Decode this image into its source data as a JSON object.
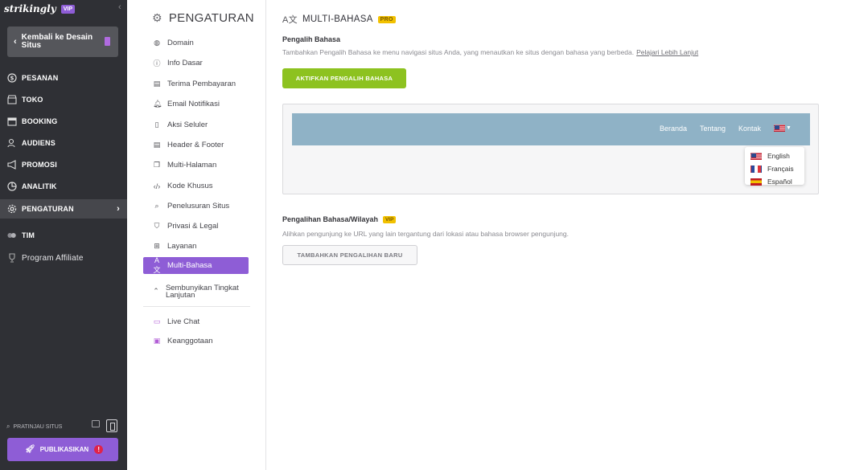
{
  "brand": {
    "logo": "strikingly",
    "vip": "VIP"
  },
  "back": {
    "label": "Kembali ke Desain Situs"
  },
  "nav": [
    {
      "label": "PESANAN",
      "icon": "dollar-icon"
    },
    {
      "label": "TOKO",
      "icon": "store-icon"
    },
    {
      "label": "BOOKING",
      "icon": "calendar-icon"
    },
    {
      "label": "AUDIENS",
      "icon": "people-icon"
    },
    {
      "label": "PROMOSI",
      "icon": "megaphone-icon"
    },
    {
      "label": "ANALITIK",
      "icon": "chart-icon"
    },
    {
      "label": "PENGATURAN",
      "icon": "gear-icon"
    },
    {
      "label": "TIM",
      "icon": "team-icon"
    },
    {
      "label": "Program Affiliate",
      "icon": "trophy-icon"
    }
  ],
  "preview": {
    "label": "PRATINJAU SITUS"
  },
  "publish": {
    "label": "PUBLIKASIKAN"
  },
  "settings": {
    "title": "PENGATURAN",
    "items": [
      {
        "label": "Domain",
        "icon": "globe-icon"
      },
      {
        "label": "Info Dasar",
        "icon": "info-icon"
      },
      {
        "label": "Terima Pembayaran",
        "icon": "payment-icon"
      },
      {
        "label": "Email Notifikasi",
        "icon": "bell-icon"
      },
      {
        "label": "Aksi Seluler",
        "icon": "mobile-icon"
      },
      {
        "label": "Header & Footer",
        "icon": "layout-icon"
      },
      {
        "label": "Multi-Halaman",
        "icon": "pages-icon"
      },
      {
        "label": "Kode Khusus",
        "icon": "code-icon"
      },
      {
        "label": "Penelusuran Situs",
        "icon": "search-icon"
      },
      {
        "label": "Privasi & Legal",
        "icon": "shield-icon"
      },
      {
        "label": "Layanan",
        "icon": "grid-icon"
      },
      {
        "label": "Multi-Bahasa",
        "icon": "translate-icon"
      },
      {
        "label": "Sembunyikan Tingkat Lanjutan",
        "icon": "chevron-up-icon"
      },
      {
        "label": "Live Chat",
        "icon": "chat-icon"
      },
      {
        "label": "Keanggotaan",
        "icon": "member-icon"
      }
    ]
  },
  "main": {
    "title": "MULTI-BAHASA",
    "title_badge": "PRO",
    "switcher": {
      "heading": "Pengalih Bahasa",
      "desc": "Tambahkan Pengalih Bahasa ke menu navigasi situs Anda, yang menautkan ke situs dengan bahasa yang berbeda.",
      "link": "Pelajari Lebih Lanjut",
      "button": "AKTIFKAN PENGALIH BAHASA"
    },
    "demo_nav": {
      "links": [
        "Beranda",
        "Tentang",
        "Kontak"
      ]
    },
    "languages": [
      "English",
      "Français",
      "Español"
    ],
    "redirect": {
      "heading": "Pengalihan Bahasa/Wilayah",
      "badge": "VIP",
      "desc": "Alihkan pengunjung ke URL yang lain tergantung dari lokasi atau bahasa browser pengunjung.",
      "button": "TAMBAHKAN PENGALIHAN BARU"
    }
  }
}
